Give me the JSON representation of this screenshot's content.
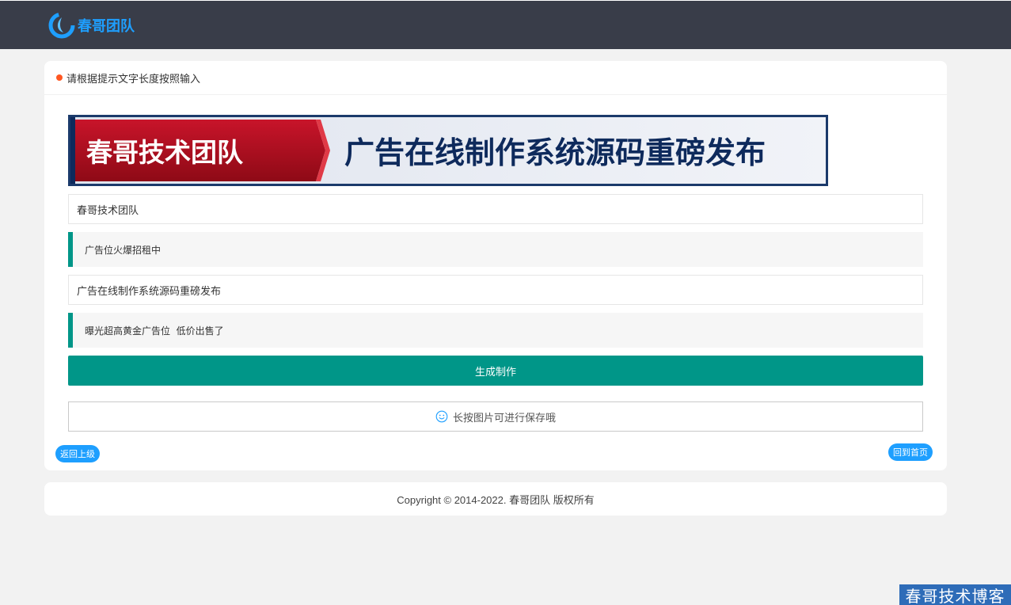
{
  "header": {
    "logo_text": "春哥团队"
  },
  "card": {
    "hint": "请根据提示文字长度按照输入",
    "banner": {
      "left_text": "春哥技术团队",
      "right_text": "广告在线制作系统源码重磅发布"
    },
    "field1": {
      "value": "春哥技术团队"
    },
    "quote1": "广告位火爆招租中",
    "field2": {
      "value": "广告在线制作系统源码重磅发布"
    },
    "quote2": "曝光超高黄金广告位  低价出售了",
    "generate_label": "生成制作",
    "save_tip": "长按图片可进行保存哦",
    "back_label": "返回上级",
    "home_label": "回到首页"
  },
  "footer": {
    "copyright": "Copyright © 2014-2022. 春哥团队 版权所有"
  },
  "watermark": "春哥技术博客",
  "colors": {
    "topbar": "#393d49",
    "accent_blue": "#1e9fff",
    "accent_green": "#009688",
    "dot_orange": "#ff5722",
    "banner_red": "#b5111e",
    "banner_navy": "#0e2a5c"
  },
  "icons": {
    "logo": "swirl-logo-icon",
    "save_tip": "smile-icon"
  }
}
